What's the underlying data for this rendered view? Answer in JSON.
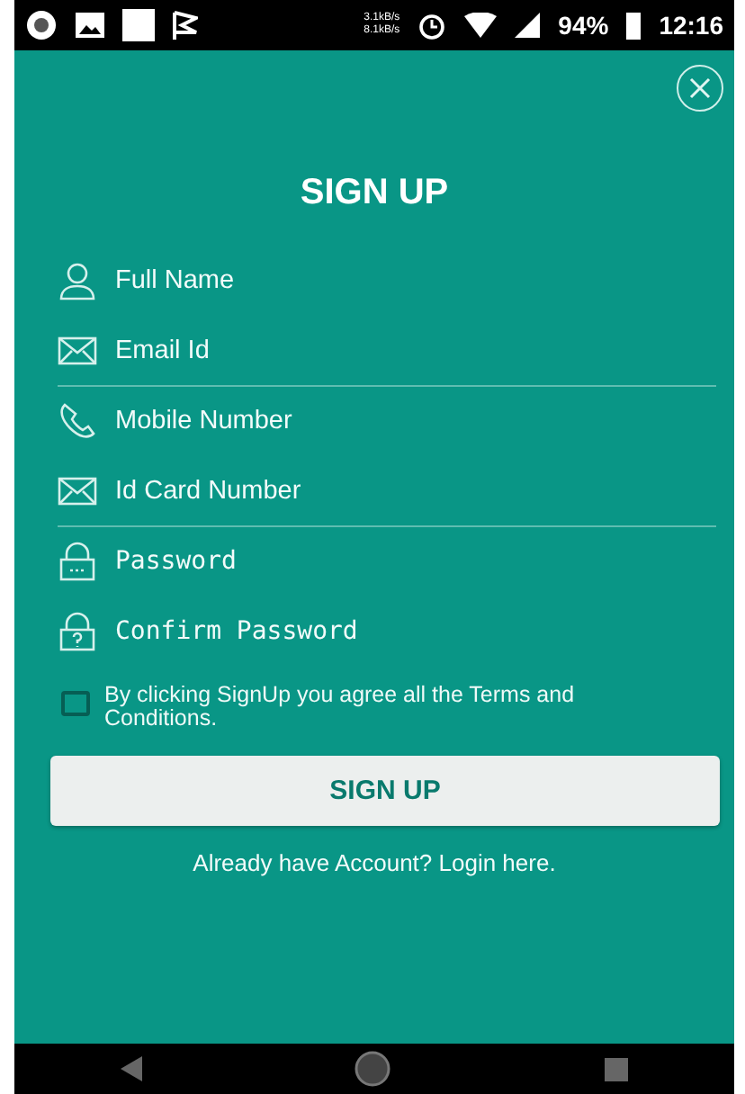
{
  "status_bar": {
    "speed_up": "3.1kB/s",
    "speed_down": "8.1kB/s",
    "battery": "94%",
    "time": "12:16"
  },
  "title": "SIGN UP",
  "fields": [
    {
      "kind": "text",
      "placeholder": "Full Name",
      "divider": false
    },
    {
      "kind": "text",
      "placeholder": "Email Id",
      "divider": true
    },
    {
      "kind": "text",
      "placeholder": "Mobile Number",
      "divider": false
    },
    {
      "kind": "text",
      "placeholder": "Id Card Number",
      "divider": true
    },
    {
      "kind": "password",
      "placeholder": "Password",
      "divider": false
    },
    {
      "kind": "password",
      "placeholder": "Confirm Password",
      "divider": false
    }
  ],
  "terms": {
    "checked": false,
    "text": "By clicking SignUp you agree all the Terms and Conditions."
  },
  "button": "SIGN UP",
  "login_link": "Already have Account? Login here."
}
